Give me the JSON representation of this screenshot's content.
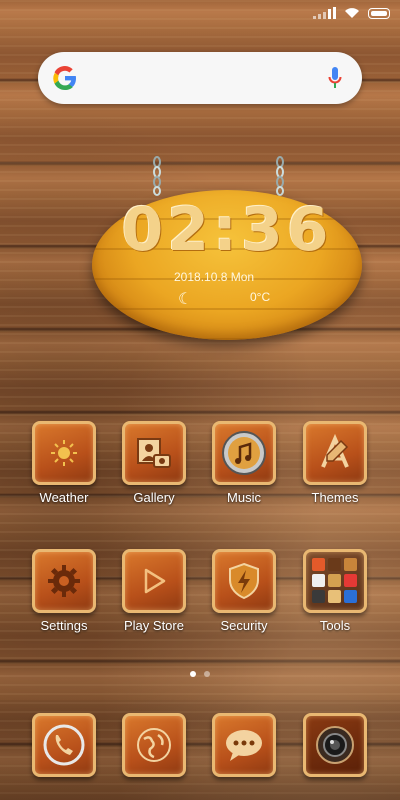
{
  "status_bar": {
    "signal_icon": "signal-icon",
    "wifi_icon": "wifi-icon",
    "battery_icon": "battery-icon"
  },
  "search_bar": {
    "logo_icon": "google-g-icon",
    "mic_icon": "microphone-icon"
  },
  "clock_widget": {
    "time": "02:36",
    "date": "2018.10.8 Mon",
    "temperature": "0°C",
    "weather_icon": "crescent-moon-icon"
  },
  "apps_row1": [
    {
      "label": "Weather",
      "icon": "sun-icon"
    },
    {
      "label": "Gallery",
      "icon": "gallery-icon"
    },
    {
      "label": "Music",
      "icon": "music-note-icon"
    },
    {
      "label": "Themes",
      "icon": "themes-icon"
    }
  ],
  "apps_row2": [
    {
      "label": "Settings",
      "icon": "gear-icon"
    },
    {
      "label": "Play Store",
      "icon": "play-store-icon"
    },
    {
      "label": "Security",
      "icon": "shield-icon"
    },
    {
      "label": "Tools",
      "icon": "tools-folder-icon"
    }
  ],
  "page_indicator": {
    "pages": 2,
    "active": 1
  },
  "dock": [
    {
      "icon": "phone-icon"
    },
    {
      "icon": "browser-globe-icon"
    },
    {
      "icon": "messages-icon"
    },
    {
      "icon": "camera-icon"
    }
  ],
  "colors": {
    "accent_wood": "#b8501a",
    "tile_border": "#e9b872",
    "sign_yellow": "#eba622"
  }
}
